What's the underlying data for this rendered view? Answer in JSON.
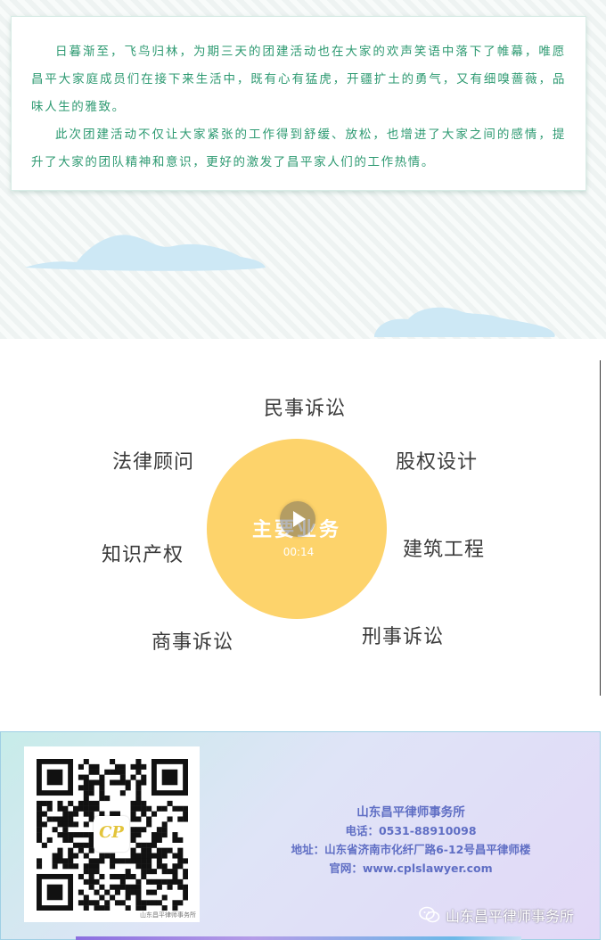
{
  "article": {
    "paragraphs": [
      "日暮渐至，飞鸟归林，为期三天的团建活动也在大家的欢声笑语中落下了帷幕，唯愿昌平大家庭成员们在接下来生活中，既有心有猛虎，开疆扩土的勇气，又有细嗅蔷薇，品味人生的雅致。",
      "此次团建活动不仅让大家紧张的工作得到舒缓、放松，也增进了大家之间的感情，提升了大家的团队精神和意识，更好的激发了昌平家人们的工作热情。"
    ]
  },
  "video": {
    "center_title": "主要业务",
    "duration": "00:14",
    "practice_areas": {
      "civil": "民事诉讼",
      "equity": "股权设计",
      "construction": "建筑工程",
      "criminal": "刑事诉讼",
      "commercial": "商事诉讼",
      "ip": "知识产权",
      "legal_counsel": "法律顾问"
    },
    "circle_color": "#fdd36b"
  },
  "footer": {
    "firm_name": "山东昌平律师事务所",
    "phone": "电话：0531-88910098",
    "address": "地址：山东省济南市化纤厂路6-12号昌平律师楼",
    "website": "官网：www.cplslawyer.com",
    "qr_caption": "山东昌平律师事务所",
    "qr_logo_text": "CP",
    "watermark": "山东昌平律师事务所",
    "accent_color": "#5f6ec4"
  },
  "colors": {
    "text_green": "#2e9a72",
    "cloud_blue": "#cde8f5"
  }
}
